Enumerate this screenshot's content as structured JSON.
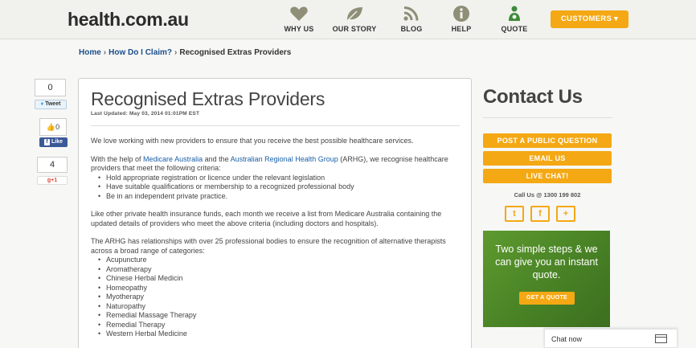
{
  "header": {
    "logo": "health.com.au",
    "nav": [
      {
        "label": "WHY US",
        "icon": "heart-icon"
      },
      {
        "label": "OUR STORY",
        "icon": "leaf-icon"
      },
      {
        "label": "BLOG",
        "icon": "rss-icon"
      },
      {
        "label": "HELP",
        "icon": "info-icon"
      },
      {
        "label": "QUOTE",
        "icon": "quote-people-icon"
      }
    ],
    "customers_button": "CUSTOMERS ▾"
  },
  "breadcrumb": {
    "home": "Home",
    "claim": "How Do I Claim?",
    "current": "Recognised Extras Providers",
    "separator": "›"
  },
  "social": {
    "tweet_count": "0",
    "tweet_label": "Tweet",
    "like_count": "0",
    "like_label": "Like",
    "gplus_count": "4",
    "gplus_label": "+1"
  },
  "article": {
    "title": "Recognised Extras Providers",
    "last_updated": "Last Updated: May 03, 2014 01:01PM EST",
    "intro": "We love working with new providers to ensure that you receive the best possible healthcare services.",
    "p2_before": "With the help of ",
    "p2_link1": "Medicare Australia",
    "p2_mid": " and the ",
    "p2_link2": "Australian Regional Health Group",
    "p2_after": " (ARHG), we recognise healthcare providers that meet the following criteria:",
    "criteria": [
      "Hold appropriate registration or licence under the relevant legislation",
      "Have suitable qualifications or membership to a recognized professional body",
      "Be in an independent private practice."
    ],
    "p3": "Like other private health insurance funds, each month we receive a list from Medicare Australia containing the updated details of providers who meet the above criteria (including doctors and hospitals).",
    "p4": "The ARHG has relationships with over 25 professional bodies to ensure the recognition of alternative therapists across a broad range of categories:",
    "categories": [
      "Acupuncture",
      "Aromatherapy",
      "Chinese Herbal Medicin",
      "Homeopathy",
      "Myotherapy",
      "Naturopathy",
      "Remedial Massage Therapy",
      "Remedial Therapy",
      "Western Herbal Medicine"
    ]
  },
  "sidebar": {
    "title": "Contact Us",
    "buttons": [
      "POST A PUBLIC QUESTION",
      "EMAIL US",
      "LIVE CHAT!"
    ],
    "call_us": "Call Us @ 1300 199 802",
    "social_icons": [
      {
        "icon": "twitter-icon",
        "glyph": "t"
      },
      {
        "icon": "facebook-icon",
        "glyph": "f"
      },
      {
        "icon": "plus-icon",
        "glyph": "+"
      }
    ],
    "promo_text": "Two simple steps & we can give you an instant quote.",
    "promo_button": "GET A QUOTE"
  },
  "chat": {
    "label": "Chat now"
  },
  "colors": {
    "accent": "#f4a814",
    "link": "#1b4f8a",
    "promo_green": "#4a8426"
  }
}
